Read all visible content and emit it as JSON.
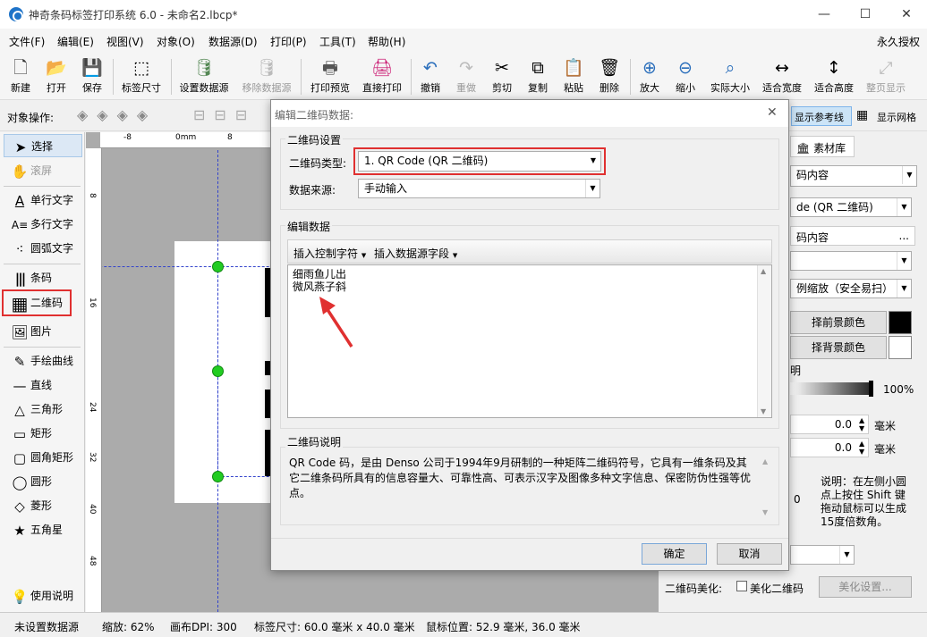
{
  "window": {
    "title": "神奇条码标签打印系统 6.0 - 未命名2.lbcp*",
    "minimize": "—",
    "maximize": "☐",
    "close": "✕"
  },
  "menu": {
    "items": [
      "文件(F)",
      "编辑(E)",
      "视图(V)",
      "对象(O)",
      "数据源(D)",
      "打印(P)",
      "工具(T)",
      "帮助(H)"
    ],
    "license": "永久授权"
  },
  "toolbar": {
    "buttons": [
      {
        "label": "新建",
        "icon": "new-file-icon",
        "glyph": "🗋"
      },
      {
        "label": "打开",
        "icon": "open-icon",
        "glyph": "📂"
      },
      {
        "label": "保存",
        "icon": "save-icon",
        "glyph": "💾"
      },
      {
        "label": "标签尺寸",
        "icon": "label-size-icon",
        "glyph": "⬚"
      },
      {
        "label": "设置数据源",
        "icon": "database-icon",
        "glyph": "🛢"
      },
      {
        "label": "移除数据源",
        "icon": "database-remove-icon",
        "glyph": "🛢"
      },
      {
        "label": "打印预览",
        "icon": "print-preview-icon",
        "glyph": "🖶"
      },
      {
        "label": "直接打印",
        "icon": "print-icon",
        "glyph": "🖨"
      },
      {
        "label": "撤销",
        "icon": "undo-icon",
        "glyph": "↶"
      },
      {
        "label": "重做",
        "icon": "redo-icon",
        "glyph": "↷"
      },
      {
        "label": "剪切",
        "icon": "cut-icon",
        "glyph": "✂"
      },
      {
        "label": "复制",
        "icon": "copy-icon",
        "glyph": "⧉"
      },
      {
        "label": "粘贴",
        "icon": "paste-icon",
        "glyph": "📋"
      },
      {
        "label": "删除",
        "icon": "delete-icon",
        "glyph": "🗑"
      },
      {
        "label": "放大",
        "icon": "zoom-in-icon",
        "glyph": "⊕"
      },
      {
        "label": "缩小",
        "icon": "zoom-out-icon",
        "glyph": "⊖"
      },
      {
        "label": "实际大小",
        "icon": "actual-size-icon",
        "glyph": "⌕"
      },
      {
        "label": "适合宽度",
        "icon": "fit-width-icon",
        "glyph": "↔"
      },
      {
        "label": "适合高度",
        "icon": "fit-height-icon",
        "glyph": "↕"
      },
      {
        "label": "整页显示",
        "icon": "full-page-icon",
        "glyph": "⤢"
      }
    ]
  },
  "objbar": {
    "label": "对象操作:",
    "show_guides": "显示参考线",
    "show_grid": "显示网格"
  },
  "left_tools": [
    {
      "label": "选择",
      "icon": "cursor-icon",
      "glyph": "➤"
    },
    {
      "label": "滚屏",
      "icon": "hand-icon",
      "glyph": "✋"
    },
    {
      "label": "单行文字",
      "icon": "text-single-icon",
      "glyph": "A"
    },
    {
      "label": "多行文字",
      "icon": "text-multi-icon",
      "glyph": "A≡"
    },
    {
      "label": "圆弧文字",
      "icon": "text-arc-icon",
      "glyph": "⁖"
    },
    {
      "label": "条码",
      "icon": "barcode-icon",
      "glyph": "|||"
    },
    {
      "label": "二维码",
      "icon": "qrcode-icon",
      "glyph": "▦"
    },
    {
      "label": "图片",
      "icon": "image-icon",
      "glyph": "🖼"
    },
    {
      "label": "手绘曲线",
      "icon": "pencil-icon",
      "glyph": "✎"
    },
    {
      "label": "直线",
      "icon": "line-icon",
      "glyph": "—"
    },
    {
      "label": "三角形",
      "icon": "triangle-icon",
      "glyph": "△"
    },
    {
      "label": "矩形",
      "icon": "rectangle-icon",
      "glyph": "▭"
    },
    {
      "label": "圆角矩形",
      "icon": "rounded-rect-icon",
      "glyph": "▢"
    },
    {
      "label": "圆形",
      "icon": "circle-icon",
      "glyph": "◯"
    },
    {
      "label": "菱形",
      "icon": "diamond-icon",
      "glyph": "◇"
    },
    {
      "label": "五角星",
      "icon": "star-icon",
      "glyph": "★"
    }
  ],
  "help": {
    "label": "使用说明",
    "icon": "bulb-icon"
  },
  "ruler": {
    "h_ticks": [
      "-8",
      "0mm",
      "8"
    ],
    "v_ticks": [
      "8",
      "16",
      "24",
      "32",
      "40",
      "48"
    ]
  },
  "right_panel": {
    "tab_library": "素材库",
    "content_combo": "码内容",
    "qr_type_combo": "de (QR 二维码)",
    "content_label": "码内容",
    "scale_combo": "例缩放（安全易扫）",
    "fg_button": "择前景颜色",
    "bg_button": "择背景颜色",
    "opacity_label": "明",
    "opacity_value": "100%",
    "val1": "0.0",
    "val2": "0.0",
    "unit": "毫米",
    "zero": "0",
    "note": "说明：在左侧小圆点上按住 Shift 键拖动鼠标可以生成15度倍数角。",
    "beautify_label": "二维码美化:",
    "beautify_checkbox": "美化二维码",
    "beautify_button": "美化设置..."
  },
  "status": {
    "datasource": "未设置数据源",
    "zoom": "缩放: 62%",
    "dpi": "画布DPI: 300",
    "label_size": "标签尺寸: 60.0 毫米 x 40.0 毫米",
    "mouse": "鼠标位置: 52.9 毫米, 36.0 毫米"
  },
  "dialog": {
    "title": "编辑二维码数据:",
    "close": "✕",
    "settings_group": "二维码设置",
    "type_label": "二维码类型:",
    "type_value": "1. QR Code (QR 二维码)",
    "source_label": "数据来源:",
    "source_value": "手动输入",
    "edit_group": "编辑数据",
    "insert_ctrl": "插入控制字符",
    "insert_field": "插入数据源字段",
    "data_text": "细雨鱼儿出\n微风燕子斜",
    "desc_group": "二维码说明",
    "desc_text": "QR Code 码，是由 Denso 公司于1994年9月研制的一种矩阵二维码符号，它具有一维条码及其它二维条码所具有的信息容量大、可靠性高、可表示汉字及图像多种文字信息、保密防伪性强等优点。",
    "ok": "确定",
    "cancel": "取消"
  },
  "colors": {
    "accent_red": "#e03030",
    "handle_green": "#22cc22",
    "guide_blue": "#3344cc"
  }
}
